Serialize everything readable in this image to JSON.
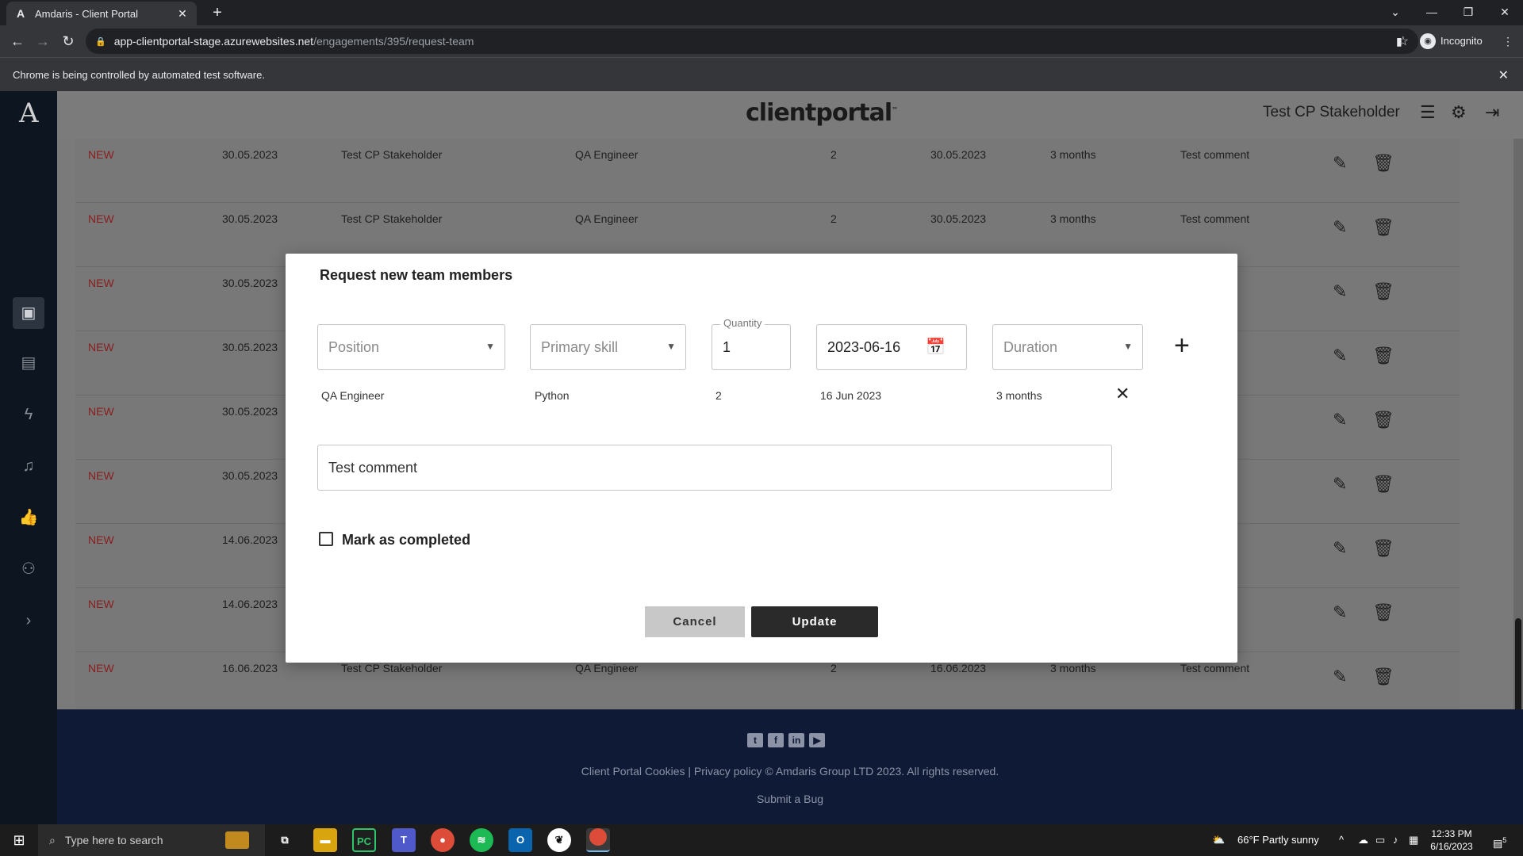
{
  "browser": {
    "tab_title": "Amdaris - Client Portal",
    "favicon_letter": "A",
    "url_host": "app-clientportal-stage.azurewebsites.net",
    "url_path": "/engagements/395/request-team",
    "profile_label": "Incognito",
    "infobar_text": "Chrome is being controlled by automated test software."
  },
  "app": {
    "brand": "clientportal",
    "brand_tm": "™",
    "user_name": "Test CP Stakeholder"
  },
  "table": {
    "rows": [
      {
        "status": "NEW",
        "date": "30.05.2023",
        "name": "Test CP Stakeholder",
        "position": "QA Engineer",
        "qty": "2",
        "start": "30.05.2023",
        "duration": "3 months",
        "comment": "Test comment"
      },
      {
        "status": "NEW",
        "date": "30.05.2023",
        "name": "Test CP Stakeholder",
        "position": "QA Engineer",
        "qty": "2",
        "start": "30.05.2023",
        "duration": "3 months",
        "comment": "Test comment"
      },
      {
        "status": "NEW",
        "date": "30.05.2023",
        "name": "",
        "position": "",
        "qty": "",
        "start": "",
        "duration": "",
        "comment": "ent"
      },
      {
        "status": "NEW",
        "date": "30.05.2023",
        "name": "",
        "position": "",
        "qty": "",
        "start": "",
        "duration": "",
        "comment": "ent"
      },
      {
        "status": "NEW",
        "date": "30.05.2023",
        "name": "",
        "position": "",
        "qty": "",
        "start": "",
        "duration": "",
        "comment": "ent"
      },
      {
        "status": "NEW",
        "date": "30.05.2023",
        "name": "",
        "position": "",
        "qty": "",
        "start": "",
        "duration": "",
        "comment": "ent"
      },
      {
        "status": "NEW",
        "date": "14.06.2023",
        "name": "",
        "position": "",
        "qty": "",
        "start": "",
        "duration": "",
        "comment": "ent"
      },
      {
        "status": "NEW",
        "date": "14.06.2023",
        "name": "",
        "position": "",
        "qty": "",
        "start": "",
        "duration": "",
        "comment": "ent"
      },
      {
        "status": "NEW",
        "date": "16.06.2023",
        "name": "Test CP Stakeholder",
        "position": "QA Engineer",
        "qty": "2",
        "start": "16.06.2023",
        "duration": "3 months",
        "comment": "Test comment"
      }
    ]
  },
  "modal": {
    "title": "Request new team members",
    "position_placeholder": "Position",
    "skill_placeholder": "Primary skill",
    "quantity_label": "Quantity",
    "quantity_value": "1",
    "date_value": "2023-06-16",
    "duration_placeholder": "Duration",
    "item": {
      "position": "QA Engineer",
      "skill": "Python",
      "qty": "2",
      "date": "16 Jun 2023",
      "duration": "3 months"
    },
    "comment": "Test comment",
    "checkbox_label": "Mark as completed",
    "checkbox_checked": false,
    "cancel_label": "Cancel",
    "update_label": "Update"
  },
  "footer": {
    "links_text": "Client Portal Cookies | Privacy policy © Amdaris Group LTD 2023. All rights reserved.",
    "bug_link": "Submit a Bug",
    "social": [
      "twitter-icon",
      "facebook-icon",
      "linkedin-icon",
      "youtube-icon"
    ]
  },
  "taskbar": {
    "search_placeholder": "Type here to search",
    "weather": "66°F  Partly sunny",
    "time": "12:33 PM",
    "date": "6/16/2023",
    "notification_count": "5"
  },
  "colors": {
    "status_new": "#8a1d1d",
    "update_button": "#2a2a2a",
    "sidebar": "#0d1521",
    "footer": "#0f1a36"
  }
}
